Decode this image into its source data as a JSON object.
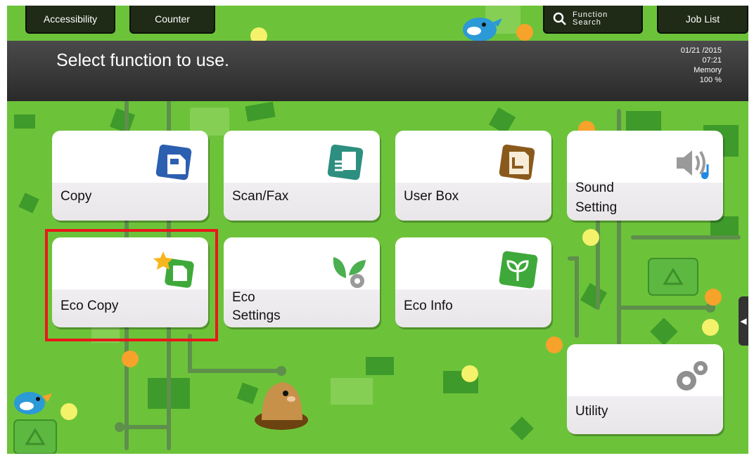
{
  "top_buttons": {
    "accessibility": "Accessibility",
    "counter": "Counter",
    "function_search": "Function Search",
    "job_list": "Job List"
  },
  "message": "Select function to use.",
  "status": {
    "date": "01/21 /2015",
    "time": "07:21",
    "memory_label": "Memory",
    "memory_value": "100 %"
  },
  "tiles": {
    "copy": "Copy",
    "scan_fax": "Scan/Fax",
    "user_box": "User Box",
    "sound_setting_1": "Sound",
    "sound_setting_2": "Setting",
    "eco_copy": "Eco Copy",
    "eco_settings_1": "Eco",
    "eco_settings_2": "Settings",
    "eco_info": "Eco Info",
    "utility": "Utility"
  },
  "colors": {
    "background_green": "#6cc33a",
    "dark_green": "#2e8b2e",
    "highlight_red": "#e8191b",
    "copy_icon_blue": "#2c5fb0",
    "scan_icon_teal": "#2d8f7f",
    "user_box_brown": "#8a5a1c",
    "eco_green": "#3ea93a"
  },
  "icons": [
    "search-icon",
    "bird-icon",
    "copy-icon",
    "scan-fax-icon",
    "user-box-icon",
    "speaker-icon",
    "eco-copy-icon",
    "leaf-gear-icon",
    "leaf-icon",
    "gears-icon",
    "recycle-icon",
    "mole-icon"
  ]
}
